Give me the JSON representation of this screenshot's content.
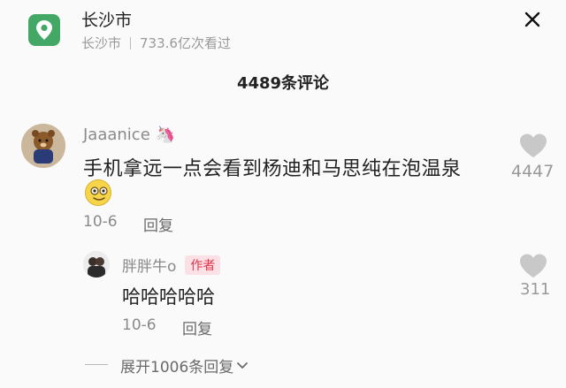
{
  "header": {
    "location_icon": "location-pin-icon",
    "title": "长沙市",
    "subtitle_place": "长沙市",
    "subtitle_views": "733.6亿次看过",
    "close_icon": "close-icon"
  },
  "comments_header": {
    "count_label": "4489条评论"
  },
  "comment": {
    "username": "Jaaanice",
    "username_emoji": "🦄",
    "text": "手机拿远一点会看到杨迪和马思纯在泡温泉",
    "date": "10-6",
    "reply_label": "回复",
    "like_count": "4447"
  },
  "reply": {
    "username": "胖胖牛o",
    "badge": "作者",
    "text": "哈哈哈哈哈",
    "date": "10-6",
    "reply_label": "回复",
    "like_count": "311"
  },
  "expand": {
    "label": "展开1006条回复"
  },
  "colors": {
    "accent_green": "#43a866",
    "badge_red": "#e2344b",
    "badge_bg": "#fbe1e6"
  }
}
